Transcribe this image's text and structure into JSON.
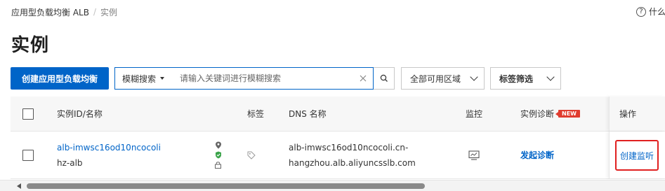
{
  "breadcrumb": {
    "root": "应用型负载均衡 ALB",
    "sep": "/",
    "current": "实例"
  },
  "help": {
    "icon_glyph": "?",
    "label": "什么"
  },
  "page_title": "实例",
  "toolbar": {
    "create_button": "创建应用型负载均衡",
    "search_type": "模糊搜索",
    "search_placeholder": "请输入关键词进行模糊搜索",
    "zone_select": "全部可用区域",
    "tag_filter": "标签筛选"
  },
  "table": {
    "headers": {
      "instance": "实例ID/名称",
      "tags": "标签",
      "dns": "DNS 名称",
      "monitor": "监控",
      "diagnosis": "实例诊断",
      "diagnosis_badge": "NEW",
      "actions": "操作"
    },
    "rows": [
      {
        "instance_id": "alb-imwsc16od10ncocoli",
        "instance_name": "hz-alb",
        "dns_line1": "alb-imwsc16od10ncocoli.cn-",
        "dns_line2": "hangzhou.alb.aliyuncsslb.com",
        "diagnose_action": "发起诊断",
        "action": "创建监听"
      }
    ]
  },
  "icons": {
    "location": "location-pin-icon",
    "shield": "shield-icon",
    "lock": "lock-icon",
    "tag": "tag-icon",
    "monitor": "monitor-icon"
  },
  "colors": {
    "primary": "#0064c8",
    "badge": "#e03c2f",
    "highlight": "#e02020"
  }
}
